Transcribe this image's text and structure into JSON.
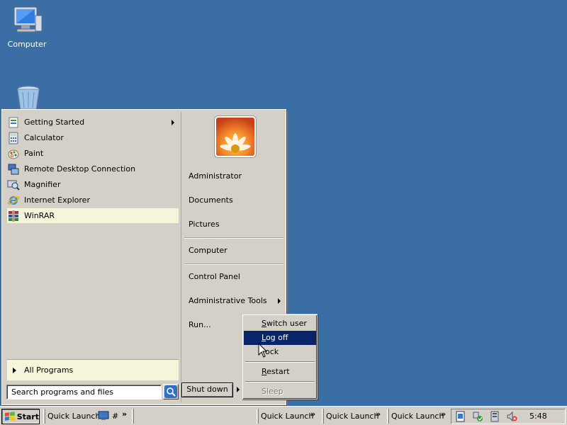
{
  "desktop": {
    "icons": [
      {
        "label": "Computer",
        "icon": "computer-icon"
      },
      {
        "label": "",
        "icon": "recycle-bin-icon"
      }
    ]
  },
  "start_menu": {
    "programs": [
      {
        "label": "Getting Started",
        "icon": "getting-started-icon",
        "has_submenu": true
      },
      {
        "label": "Calculator",
        "icon": "calculator-icon"
      },
      {
        "label": "Paint",
        "icon": "paint-icon"
      },
      {
        "label": "Remote Desktop Connection",
        "icon": "remote-desktop-icon"
      },
      {
        "label": "Magnifier",
        "icon": "magnifier-icon"
      },
      {
        "label": "Internet Explorer",
        "icon": "internet-explorer-icon"
      },
      {
        "label": "WinRAR",
        "icon": "winrar-icon",
        "highlighted": true
      }
    ],
    "all_programs": "All Programs",
    "search_placeholder": "Search programs and files",
    "right_items": [
      {
        "label": "Administrator"
      },
      {
        "label": "Documents"
      },
      {
        "label": "Pictures"
      },
      {
        "label": "Computer"
      },
      {
        "label": "Control Panel"
      },
      {
        "label": "Administrative Tools",
        "has_submenu": true
      },
      {
        "label": "Run..."
      }
    ],
    "shutdown_label": "Shut down"
  },
  "shutdown_menu": {
    "items": [
      {
        "prefix": "",
        "accel": "S",
        "rest": "witch user"
      },
      {
        "prefix": "",
        "accel": "L",
        "rest": "og off",
        "selected": true
      },
      {
        "prefix": "",
        "accel": "",
        "rest": "ock"
      },
      {
        "prefix": "",
        "accel": "R",
        "rest": "estart"
      },
      {
        "prefix": "",
        "accel": "",
        "rest": "Sleep",
        "disabled": true
      }
    ]
  },
  "taskbar": {
    "start_label": "Start",
    "quick_launch_1": "Quick Launch",
    "hash_label": "#",
    "quick_launch_2": "Quick Launch",
    "quick_launch_3": "Quick Launch",
    "quick_launch_4": "Quick Launch",
    "chevron": "»",
    "clock": "5:48"
  },
  "colors": {
    "desktop": "#3a6ea5",
    "selection": "#0a246a",
    "highlight": "#f6f5da"
  }
}
